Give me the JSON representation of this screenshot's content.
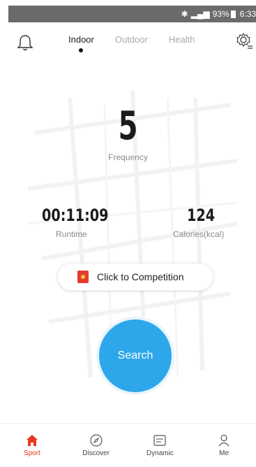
{
  "status_bar": {
    "bluetooth_icon": "bluetooth-icon",
    "signal_icon": "signal-icon",
    "battery": "93%",
    "time": "6:33"
  },
  "header": {
    "bell_icon": "bell-icon",
    "settings_icon": "settings-gear-icon",
    "tabs": [
      {
        "label": "Indoor",
        "active": true
      },
      {
        "label": "Outdoor",
        "active": false
      },
      {
        "label": "Health",
        "active": false
      }
    ]
  },
  "stats": {
    "frequency": {
      "value": "5",
      "label": "Frequency"
    },
    "runtime": {
      "value": "00:11:09",
      "label": "Runtime"
    },
    "calories": {
      "value": "124",
      "label": "Calories(kcal)"
    }
  },
  "competition": {
    "icon": "red-packet-icon",
    "label": "Click to Competition"
  },
  "search": {
    "label": "Search"
  },
  "bottom_nav": [
    {
      "label": "Sport",
      "icon": "home-icon",
      "active": true
    },
    {
      "label": "Discover",
      "icon": "compass-icon",
      "active": false
    },
    {
      "label": "Dynamic",
      "icon": "dynamic-icon",
      "active": false
    },
    {
      "label": "Me",
      "icon": "user-icon",
      "active": false
    }
  ],
  "colors": {
    "accent_blue": "#2ea7ea",
    "accent_red": "#e5391f",
    "status_bar_bg": "#6b6b6b"
  }
}
